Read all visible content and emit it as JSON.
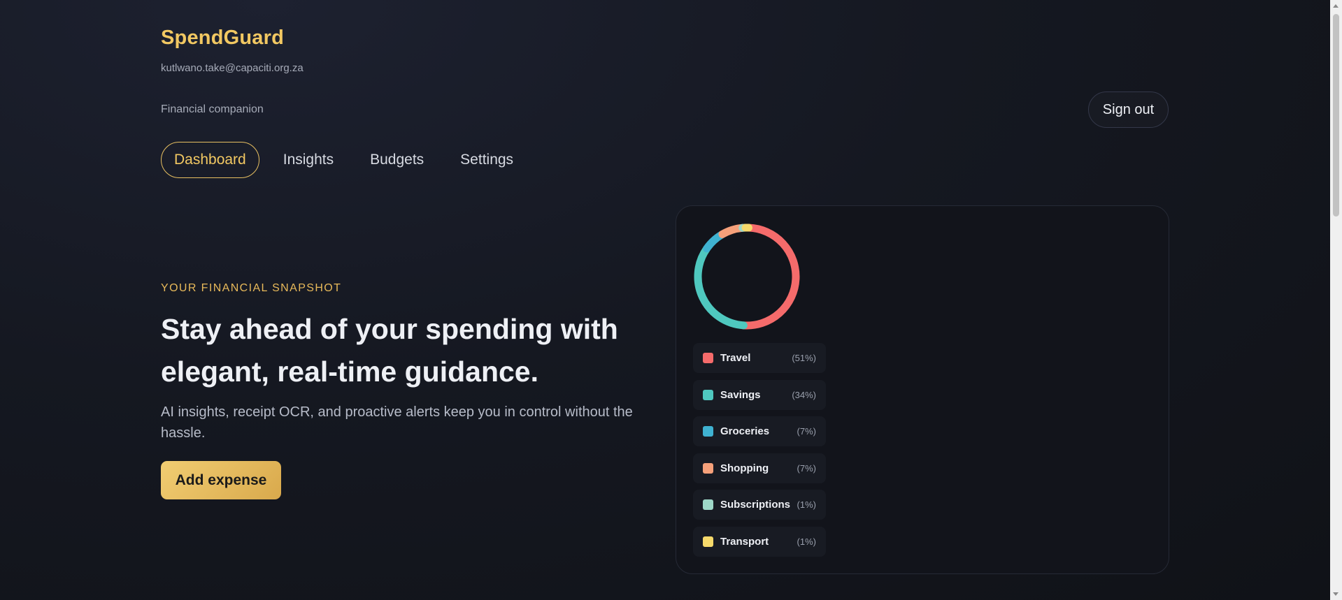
{
  "app": {
    "brand": "SpendGuard",
    "email": "kutlwano.take@capaciti.org.za",
    "tagline": "Financial companion",
    "sign_out": "Sign out"
  },
  "nav": {
    "tabs": [
      {
        "label": "Dashboard",
        "active": true
      },
      {
        "label": "Insights",
        "active": false
      },
      {
        "label": "Budgets",
        "active": false
      },
      {
        "label": "Settings",
        "active": false
      }
    ]
  },
  "hero": {
    "kicker": "YOUR FINANCIAL SNAPSHOT",
    "headline": "Stay ahead of your spending with elegant, real-time guidance.",
    "subtext": "AI insights, receipt OCR, and proactive alerts keep you in control without the hassle.",
    "cta": "Add expense"
  },
  "spending": {
    "categories": [
      {
        "name": "Travel",
        "pct_label": "(51%)",
        "value": 51,
        "color": "#f56b6b"
      },
      {
        "name": "Savings",
        "pct_label": "(34%)",
        "value": 34,
        "color": "#4fc8bf"
      },
      {
        "name": "Groceries",
        "pct_label": "(7%)",
        "value": 7,
        "color": "#3fb2d1"
      },
      {
        "name": "Shopping",
        "pct_label": "(7%)",
        "value": 7,
        "color": "#f5a07a"
      },
      {
        "name": "Subscriptions",
        "pct_label": "(1%)",
        "value": 1,
        "color": "#9ed8c8"
      },
      {
        "name": "Transport",
        "pct_label": "(1%)",
        "value": 1,
        "color": "#f6d96b"
      }
    ]
  },
  "colors": {
    "accent": "#f2c862",
    "background": "#151821"
  }
}
